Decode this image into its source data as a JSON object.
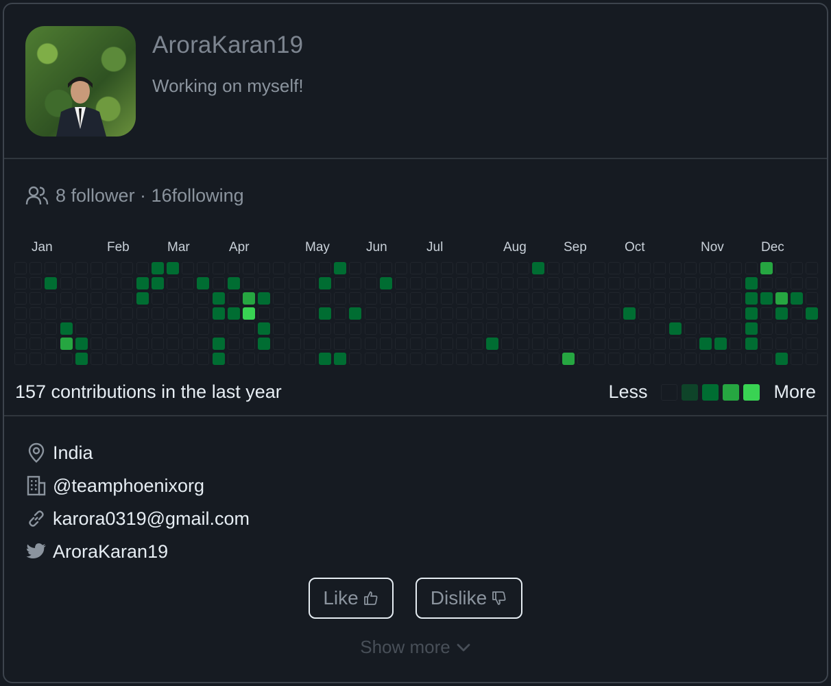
{
  "profile": {
    "username": "AroraKaran19",
    "bio": "Working on myself!"
  },
  "follow": {
    "text": "8 follower · 16following"
  },
  "contributions": {
    "months": [
      "Jan",
      "Feb",
      "Mar",
      "Apr",
      "May",
      "Jun",
      "Jul",
      "Aug",
      "Sep",
      "Oct",
      "Nov",
      "Dec"
    ],
    "summary": "157 contributions in the last year",
    "legend_less": "Less",
    "legend_more": "More",
    "levels_colors": [
      "#161b22",
      "#0e4429",
      "#006d32",
      "#26a641",
      "#39d353"
    ],
    "cells": [
      [
        9,
        0,
        2
      ],
      [
        10,
        0,
        2
      ],
      [
        21,
        0,
        2
      ],
      [
        34,
        0,
        2
      ],
      [
        49,
        0,
        3
      ],
      [
        2,
        1,
        2
      ],
      [
        8,
        1,
        2
      ],
      [
        9,
        1,
        2
      ],
      [
        12,
        1,
        2
      ],
      [
        14,
        1,
        2
      ],
      [
        20,
        1,
        2
      ],
      [
        24,
        1,
        2
      ],
      [
        48,
        1,
        2
      ],
      [
        8,
        2,
        2
      ],
      [
        13,
        2,
        2
      ],
      [
        15,
        2,
        3
      ],
      [
        16,
        2,
        2
      ],
      [
        48,
        2,
        2
      ],
      [
        49,
        2,
        2
      ],
      [
        50,
        2,
        3
      ],
      [
        51,
        2,
        2
      ],
      [
        13,
        3,
        2
      ],
      [
        14,
        3,
        2
      ],
      [
        15,
        3,
        4
      ],
      [
        20,
        3,
        2
      ],
      [
        22,
        3,
        2
      ],
      [
        40,
        3,
        2
      ],
      [
        48,
        3,
        2
      ],
      [
        50,
        3,
        2
      ],
      [
        52,
        3,
        2
      ],
      [
        3,
        4,
        2
      ],
      [
        16,
        4,
        2
      ],
      [
        43,
        4,
        2
      ],
      [
        48,
        4,
        2
      ],
      [
        3,
        5,
        3
      ],
      [
        4,
        5,
        2
      ],
      [
        13,
        5,
        2
      ],
      [
        16,
        5,
        2
      ],
      [
        31,
        5,
        2
      ],
      [
        45,
        5,
        2
      ],
      [
        46,
        5,
        2
      ],
      [
        48,
        5,
        2
      ],
      [
        4,
        6,
        2
      ],
      [
        13,
        6,
        2
      ],
      [
        20,
        6,
        2
      ],
      [
        21,
        6,
        2
      ],
      [
        36,
        6,
        3
      ],
      [
        50,
        6,
        2
      ]
    ]
  },
  "info": {
    "location": "India",
    "company": "@teamphoenixorg",
    "email": "karora0319@gmail.com",
    "twitter": "AroraKaran19"
  },
  "actions": {
    "like_label": "Like",
    "dislike_label": "Dislike",
    "show_more_label": "Show more"
  },
  "icons": {
    "follow": "people-icon",
    "location": "location-pin-icon",
    "company": "building-icon",
    "email": "link-icon",
    "twitter": "twitter-icon",
    "like": "thumbs-up-icon",
    "dislike": "thumbs-down-icon",
    "show_more": "chevron-down-icon"
  }
}
